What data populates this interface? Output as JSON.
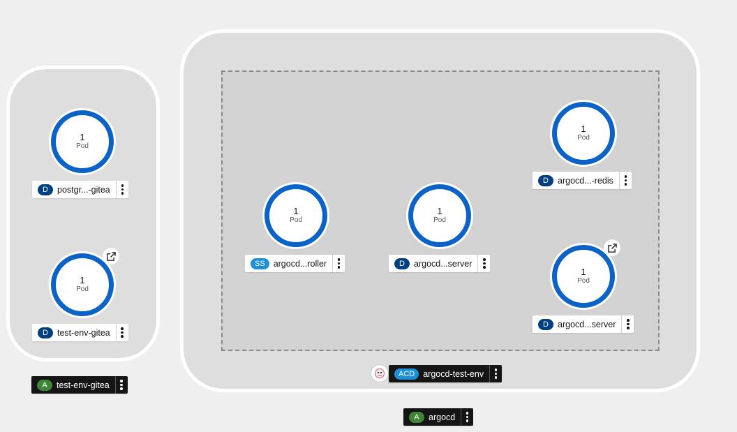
{
  "groups": {
    "test_env_gitea": {
      "label": "test-env-gitea",
      "badge": "A",
      "nodes": [
        {
          "count": "1",
          "unit": "Pod",
          "badge": "D",
          "label": "postgr...-gitea"
        },
        {
          "count": "1",
          "unit": "Pod",
          "badge": "D",
          "label": "test-env-gitea"
        }
      ]
    },
    "argocd": {
      "label": "argocd",
      "badge": "A",
      "cluster": {
        "badge": "ACD",
        "label": "argocd-test-env"
      },
      "nodes": [
        {
          "count": "1",
          "unit": "Pod",
          "badge": "SS",
          "label": "argocd...roller"
        },
        {
          "count": "1",
          "unit": "Pod",
          "badge": "D",
          "label": "argocd...server"
        },
        {
          "count": "1",
          "unit": "Pod",
          "badge": "D",
          "label": "argocd...-redis"
        },
        {
          "count": "1",
          "unit": "Pod",
          "badge": "D",
          "label": "argocd...server"
        }
      ]
    }
  },
  "colors": {
    "pod_ring": "#0b63c7",
    "badge_deployment": "#004080",
    "badge_statefulset": "#1e8fd6",
    "badge_application": "#3e8635"
  },
  "icons": {
    "external_link": "external-link-icon",
    "kebab": "kebab-menu-icon",
    "argo": "argo-logo-icon"
  }
}
